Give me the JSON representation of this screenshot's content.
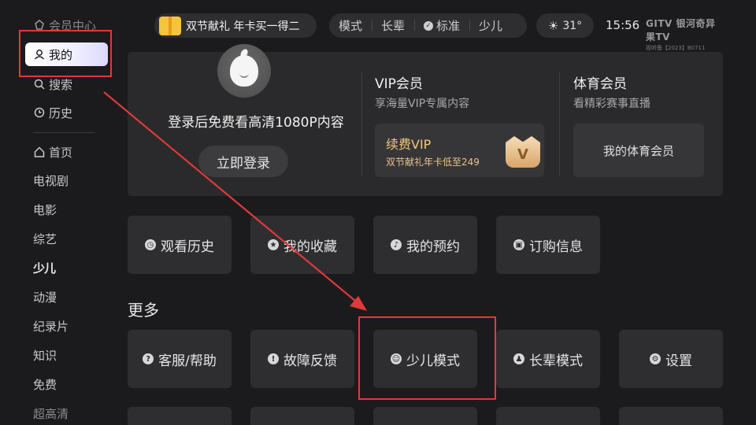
{
  "sidebar": {
    "items": [
      {
        "label": "会员中心",
        "icon": "member-icon"
      },
      {
        "label": "我的",
        "icon": "user-icon"
      },
      {
        "label": "搜索",
        "icon": "search-icon"
      },
      {
        "label": "历史",
        "icon": "clock-icon"
      },
      {
        "label": "首页",
        "icon": "home-icon"
      },
      {
        "label": "电视剧"
      },
      {
        "label": "电影"
      },
      {
        "label": "综艺"
      },
      {
        "label": "少儿"
      },
      {
        "label": "动漫"
      },
      {
        "label": "纪录片"
      },
      {
        "label": "知识"
      },
      {
        "label": "免费"
      },
      {
        "label": "超高清"
      }
    ]
  },
  "topbar": {
    "promo": "双节献礼 年卡买一得二",
    "modes": [
      "模式",
      "长辈",
      "标准",
      "少儿"
    ],
    "temperature": "31°",
    "time": "15:56",
    "brand": "GITV 银河奇异果TV",
    "license": "视听备【2023】B0711"
  },
  "login_card": {
    "prompt": "登录后免费看高清1080P内容",
    "login_button": "立即登录",
    "vip": {
      "title": "VIP会员",
      "subtitle": "享海量VIP专属内容",
      "renew_label": "续费VIP",
      "renew_promo": "双节献礼年卡低至249",
      "badge": "V"
    },
    "sport": {
      "title": "体育会员",
      "subtitle": "看精彩赛事直播",
      "button": "我的体育会员"
    }
  },
  "quick_tiles": [
    {
      "label": "观看历史",
      "icon": "clock-icon"
    },
    {
      "label": "我的收藏",
      "icon": "star-icon"
    },
    {
      "label": "我的预约",
      "icon": "bell-icon"
    },
    {
      "label": "订购信息",
      "icon": "bag-icon"
    }
  ],
  "more": {
    "title": "更多",
    "tiles": [
      {
        "label": "客服/帮助",
        "icon": "help-icon",
        "glyph": "?"
      },
      {
        "label": "故障反馈",
        "icon": "alert-icon",
        "glyph": "!"
      },
      {
        "label": "少儿模式",
        "icon": "kid-face-icon",
        "glyph": "☺"
      },
      {
        "label": "长辈模式",
        "icon": "elder-icon",
        "glyph": "♟"
      },
      {
        "label": "设置",
        "icon": "gear-icon",
        "glyph": "⚙"
      }
    ]
  },
  "colors": {
    "background": "#1b1b1d",
    "card": "#2a2a2c",
    "tile": "#2e2e30",
    "accent_gold": "#f3c67f",
    "annotation_red": "#e0393a"
  }
}
